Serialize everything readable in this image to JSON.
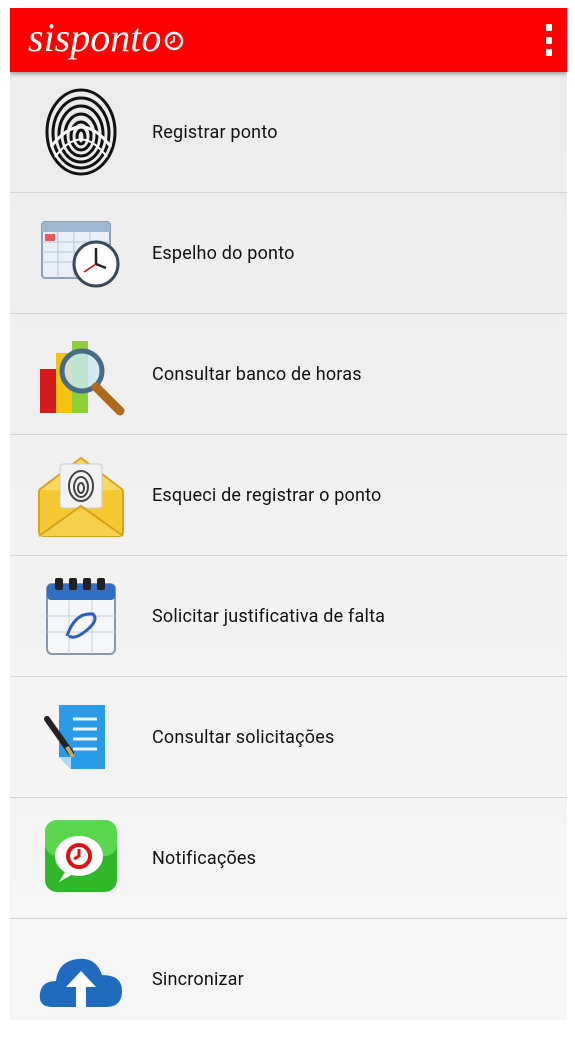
{
  "app": {
    "title": "sisponto",
    "brand_color": "#ff0000",
    "overflow_icon": "more-vert-icon"
  },
  "menu": {
    "items": [
      {
        "label": "Registrar ponto",
        "icon": "fingerprint-icon"
      },
      {
        "label": "Espelho do ponto",
        "icon": "calendar-clock-icon"
      },
      {
        "label": "Consultar banco de horas",
        "icon": "chart-magnifier-icon"
      },
      {
        "label": "Esqueci de registrar o ponto",
        "icon": "envelope-fingerprint-icon"
      },
      {
        "label": "Solicitar justificativa de falta",
        "icon": "calendar-signature-icon"
      },
      {
        "label": "Consultar solicitações",
        "icon": "document-pen-icon"
      },
      {
        "label": "Notificações",
        "icon": "notification-bubble-icon"
      },
      {
        "label": "Sincronizar",
        "icon": "cloud-upload-icon"
      }
    ]
  }
}
